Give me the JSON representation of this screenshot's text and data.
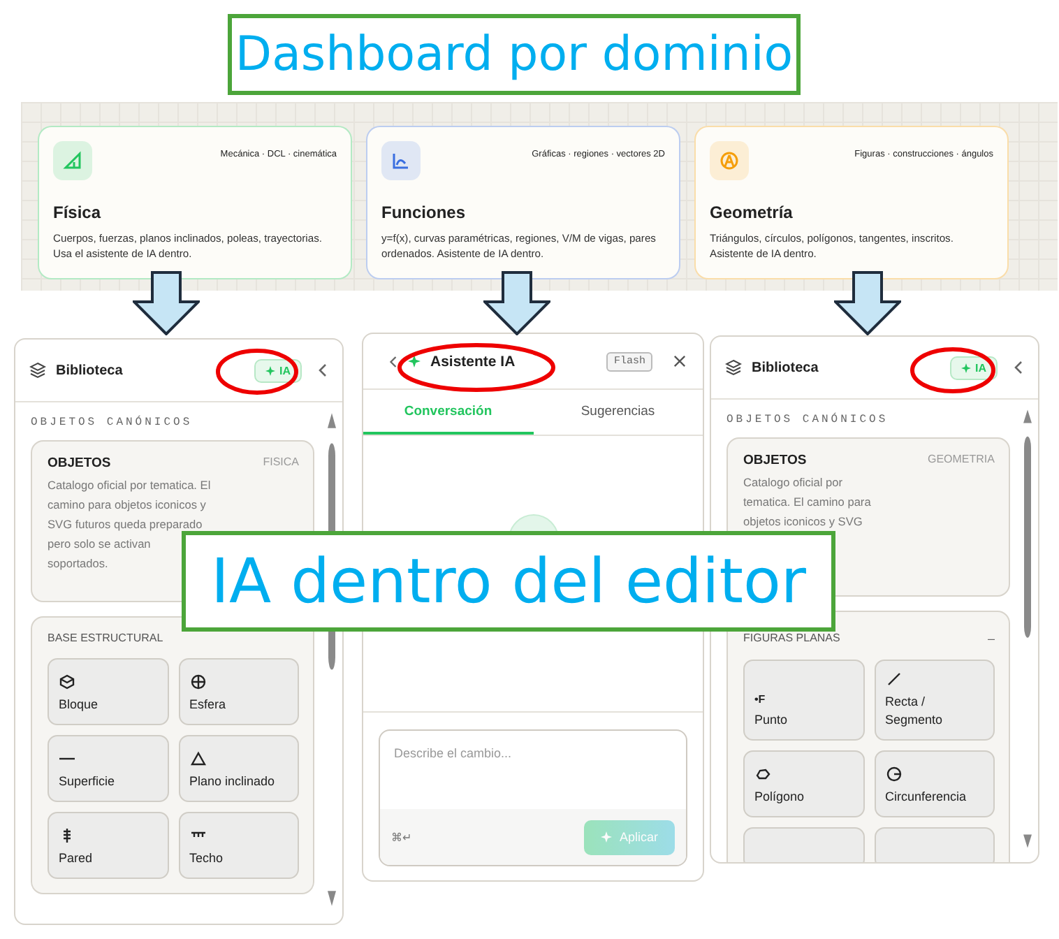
{
  "title": "Dashboard por dominio",
  "domains": [
    {
      "color": "#22c55e",
      "tag": "Mecánica · DCL · cinemática",
      "name": "Física",
      "description": "Cuerpos, fuerzas, planos inclinados, poleas, trayectorias. Usa el asistente de IA dentro."
    },
    {
      "color": "#3b6fe0",
      "tag": "Gráficas · regiones · vectores 2D",
      "name": "Funciones",
      "description": "y=f(x), curvas paramétricas, regiones, V/M de vigas, pares ordenados. Asistente de IA dentro."
    },
    {
      "color": "#f59e0b",
      "tag": "Figuras · construcciones · ángulos",
      "name": "Geometría",
      "description": "Triángulos, círculos, polígonos, tangentes, inscritos. Asistente de IA dentro."
    }
  ],
  "panels": [
    {
      "kind": "library",
      "title": "Biblioteca",
      "ia_button": "IA",
      "section": "OBJETOS CANÓNICOS",
      "card_title": "OBJETOS",
      "card_tag": "FISICA",
      "card_lines": [
        "Catalogo oficial por tematica. El",
        "camino para objetos iconicos y",
        "SVG futuros queda preparado",
        "pero solo se activan",
        "soportados."
      ],
      "group_title": "BASE ESTRUCTURAL",
      "items": [
        {
          "kind": "cube",
          "label": "Bloque"
        },
        {
          "kind": "globe",
          "label": "Esfera"
        },
        {
          "kind": "line",
          "label": "Superficie"
        },
        {
          "kind": "triangle",
          "label": "Plano inclinado"
        },
        {
          "kind": "wall",
          "label": "Pared"
        },
        {
          "kind": "ceiling",
          "label": "Techo"
        }
      ]
    },
    {
      "kind": "assistant",
      "title": "Asistente IA",
      "badge": "Flash",
      "tabs": [
        {
          "label": "Conversación",
          "selected": true
        },
        {
          "label": "Sugerencias",
          "selected": false
        }
      ],
      "placeholder": "Describe el cambio...",
      "shortcut": "⌘↵",
      "apply": {
        "label": "Aplicar",
        "disabled": true
      }
    },
    {
      "kind": "library",
      "title": "Biblioteca",
      "ia_button": "IA",
      "section": "OBJETOS CANÓNICOS",
      "card_title": "OBJETOS",
      "card_tag": "GEOMETRIA",
      "card_lines": [
        "Catalogo oficial por",
        "tematica. El camino para",
        "objetos iconicos y SVG"
      ],
      "group_title": "FIGURAS PLANAS",
      "group_toggle": "–",
      "items": [
        {
          "kind": "glyph",
          "glyph": "•F",
          "label": "Punto"
        },
        {
          "kind": "slash",
          "label": "Recta / Segmento"
        },
        {
          "kind": "blob",
          "label": "Polígono"
        },
        {
          "kind": "circle",
          "label": "Circunferencia"
        },
        {
          "kind": "empty"
        },
        {
          "kind": "empty"
        }
      ]
    }
  ],
  "overlay": "IA dentro del editor"
}
